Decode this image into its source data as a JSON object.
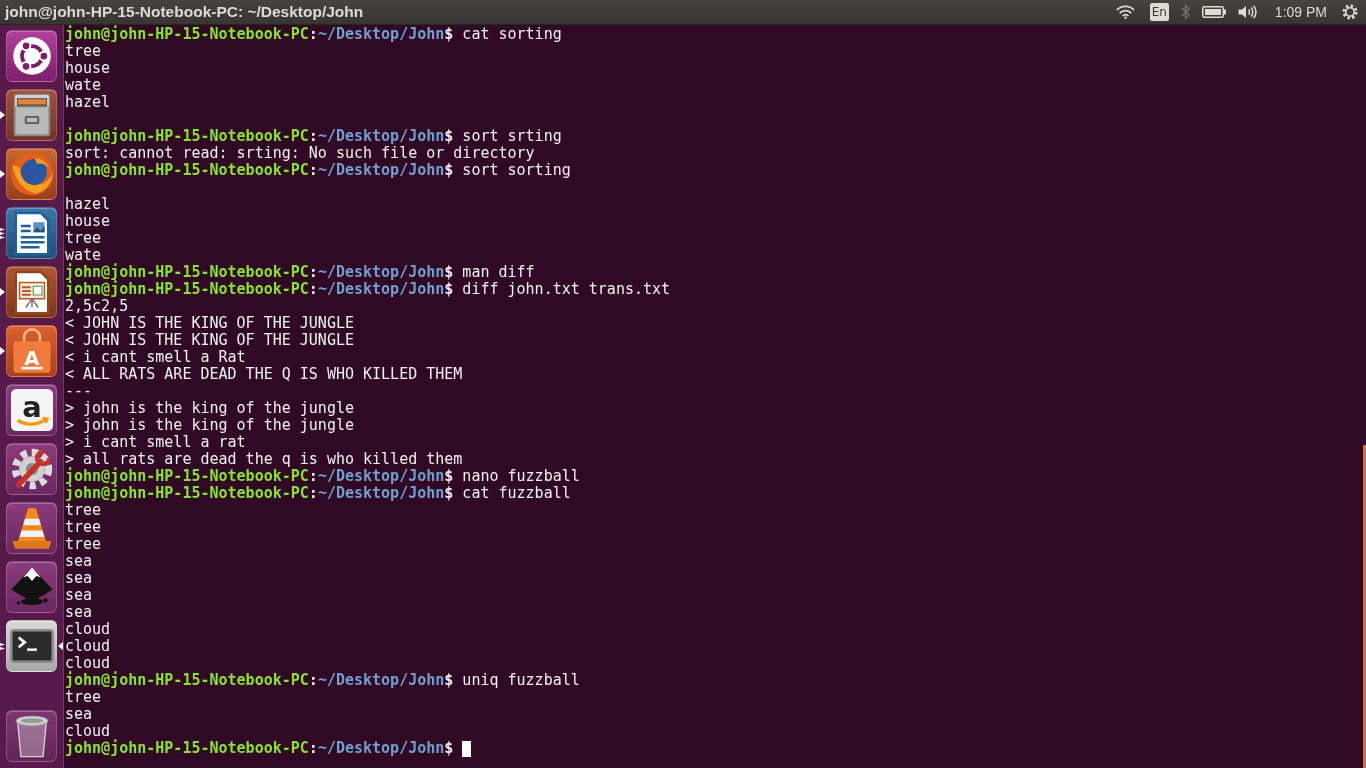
{
  "top_bar": {
    "title": "john@john-HP-15-Notebook-PC: ~/Desktop/John",
    "indicators": [
      {
        "kind": "wifi",
        "enabled": true
      },
      {
        "kind": "keyboard",
        "label": "En",
        "enabled": true
      },
      {
        "kind": "bluetooth",
        "enabled": false
      },
      {
        "kind": "battery",
        "enabled": true
      },
      {
        "kind": "volume",
        "enabled": true
      },
      {
        "kind": "clock",
        "label": "1:09 PM",
        "enabled": true
      },
      {
        "kind": "session",
        "enabled": true
      }
    ]
  },
  "launcher": {
    "items": [
      {
        "kind": "dash",
        "running": false,
        "multi_window": false,
        "many_windows": false,
        "selected": false
      },
      {
        "kind": "files",
        "running": true,
        "multi_window": false,
        "many_windows": false,
        "selected": false
      },
      {
        "kind": "browser",
        "running": true,
        "multi_window": false,
        "many_windows": false,
        "selected": false
      },
      {
        "kind": "writer",
        "running": true,
        "multi_window": true,
        "many_windows": true,
        "selected": false
      },
      {
        "kind": "impress",
        "running": true,
        "multi_window": false,
        "many_windows": false,
        "selected": false
      },
      {
        "kind": "store",
        "glyph": "A",
        "running": true,
        "multi_window": false,
        "many_windows": false,
        "selected": false
      },
      {
        "kind": "amazon",
        "glyph": "a",
        "running": false,
        "multi_window": false,
        "many_windows": false,
        "selected": false
      },
      {
        "kind": "settings",
        "running": false,
        "multi_window": false,
        "many_windows": false,
        "selected": false
      },
      {
        "kind": "vlc",
        "running": false,
        "multi_window": false,
        "many_windows": false,
        "selected": false
      },
      {
        "kind": "inkscape",
        "running": false,
        "multi_window": false,
        "many_windows": false,
        "selected": false
      },
      {
        "kind": "terminal",
        "running": true,
        "multi_window": true,
        "many_windows": false,
        "selected": true
      },
      {
        "kind": "trash",
        "running": false,
        "multi_window": false,
        "many_windows": false,
        "selected": false
      }
    ]
  },
  "terminal": {
    "lines": [
      {
        "kind": "prompt",
        "user_host": "john@john-HP-15-Notebook-PC",
        "separator": ":",
        "path": "~/Desktop/John",
        "symbol": "$",
        "command": "cat sorting"
      },
      {
        "kind": "output",
        "text": "tree"
      },
      {
        "kind": "output",
        "text": "house"
      },
      {
        "kind": "output",
        "text": "wate"
      },
      {
        "kind": "output",
        "text": "hazel"
      },
      {
        "kind": "blank"
      },
      {
        "kind": "prompt",
        "user_host": "john@john-HP-15-Notebook-PC",
        "separator": ":",
        "path": "~/Desktop/John",
        "symbol": "$",
        "command": "sort srting"
      },
      {
        "kind": "output",
        "text": "sort: cannot read: srting: No such file or directory"
      },
      {
        "kind": "prompt",
        "user_host": "john@john-HP-15-Notebook-PC",
        "separator": ":",
        "path": "~/Desktop/John",
        "symbol": "$",
        "command": "sort sorting"
      },
      {
        "kind": "blank"
      },
      {
        "kind": "output",
        "text": "hazel"
      },
      {
        "kind": "output",
        "text": "house"
      },
      {
        "kind": "output",
        "text": "tree"
      },
      {
        "kind": "output",
        "text": "wate"
      },
      {
        "kind": "prompt",
        "user_host": "john@john-HP-15-Notebook-PC",
        "separator": ":",
        "path": "~/Desktop/John",
        "symbol": "$",
        "command": "man diff"
      },
      {
        "kind": "prompt",
        "user_host": "john@john-HP-15-Notebook-PC",
        "separator": ":",
        "path": "~/Desktop/John",
        "symbol": "$",
        "command": "diff john.txt trans.txt"
      },
      {
        "kind": "output",
        "text": "2,5c2,5"
      },
      {
        "kind": "output",
        "text": "< JOHN IS THE KING OF THE JUNGLE"
      },
      {
        "kind": "output",
        "text": "< JOHN IS THE KING OF THE JUNGLE"
      },
      {
        "kind": "output",
        "text": "< i cant smell a Rat"
      },
      {
        "kind": "output",
        "text": "< ALL RATS ARE DEAD THE Q IS WHO KILLED THEM"
      },
      {
        "kind": "output",
        "text": "---"
      },
      {
        "kind": "output",
        "text": "> john is the king of the jungle"
      },
      {
        "kind": "output",
        "text": "> john is the king of the jungle"
      },
      {
        "kind": "output",
        "text": "> i cant smell a rat"
      },
      {
        "kind": "output",
        "text": "> all rats are dead the q is who killed them"
      },
      {
        "kind": "prompt",
        "user_host": "john@john-HP-15-Notebook-PC",
        "separator": ":",
        "path": "~/Desktop/John",
        "symbol": "$",
        "command": "nano fuzzball"
      },
      {
        "kind": "prompt",
        "user_host": "john@john-HP-15-Notebook-PC",
        "separator": ":",
        "path": "~/Desktop/John",
        "symbol": "$",
        "command": "cat fuzzball"
      },
      {
        "kind": "output",
        "text": "tree"
      },
      {
        "kind": "output",
        "text": "tree"
      },
      {
        "kind": "output",
        "text": "tree"
      },
      {
        "kind": "output",
        "text": "sea"
      },
      {
        "kind": "output",
        "text": "sea"
      },
      {
        "kind": "output",
        "text": "sea"
      },
      {
        "kind": "output",
        "text": "sea"
      },
      {
        "kind": "output",
        "text": "cloud"
      },
      {
        "kind": "output",
        "text": "cloud"
      },
      {
        "kind": "output",
        "text": "cloud"
      },
      {
        "kind": "prompt",
        "user_host": "john@john-HP-15-Notebook-PC",
        "separator": ":",
        "path": "~/Desktop/John",
        "symbol": "$",
        "command": "uniq fuzzball"
      },
      {
        "kind": "output",
        "text": "tree"
      },
      {
        "kind": "output",
        "text": "sea"
      },
      {
        "kind": "output",
        "text": "cloud"
      },
      {
        "kind": "prompt",
        "user_host": "john@john-HP-15-Notebook-PC",
        "separator": ":",
        "path": "~/Desktop/John",
        "symbol": "$",
        "cursor": true
      }
    ]
  }
}
